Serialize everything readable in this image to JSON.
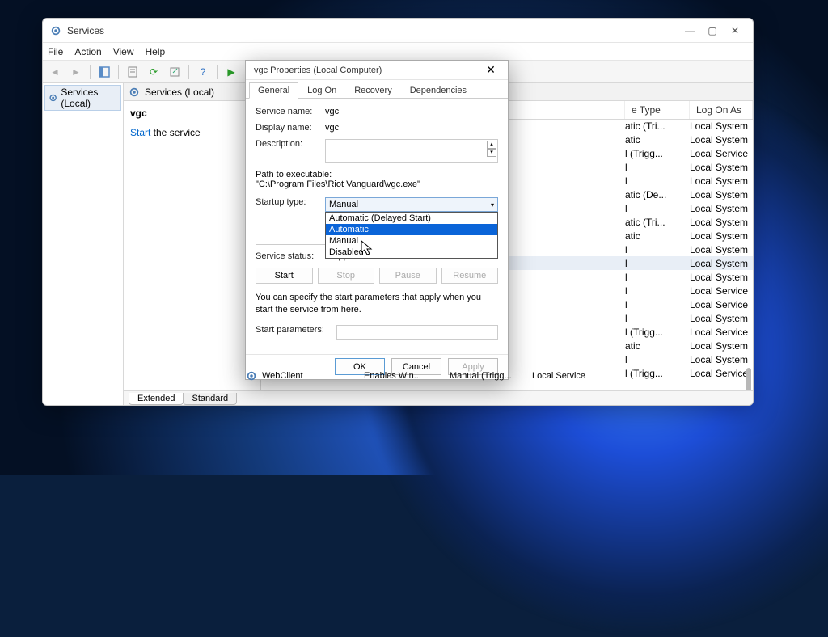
{
  "window": {
    "title": "Services",
    "menus": [
      "File",
      "Action",
      "View",
      "Help"
    ],
    "tree_label": "Services (Local)",
    "detail_header": "Services (Local)",
    "selected_service": "vgc",
    "action_link": "Start",
    "action_suffix": " the service",
    "bottom_tabs": [
      "Extended",
      "Standard"
    ],
    "columns": {
      "startup": "e Type",
      "logon": "Log On As"
    }
  },
  "rows": [
    {
      "startup": "atic (Tri...",
      "logon": "Local System"
    },
    {
      "startup": "atic",
      "logon": "Local System"
    },
    {
      "startup": "l (Trigg...",
      "logon": "Local Service"
    },
    {
      "startup": "l",
      "logon": "Local System"
    },
    {
      "startup": "l",
      "logon": "Local System"
    },
    {
      "startup": "atic (De...",
      "logon": "Local System"
    },
    {
      "startup": "l",
      "logon": "Local System"
    },
    {
      "startup": "atic (Tri...",
      "logon": "Local System"
    },
    {
      "startup": "atic",
      "logon": "Local System"
    },
    {
      "startup": "l",
      "logon": "Local System"
    },
    {
      "startup": "l",
      "logon": "Local System",
      "sel": true
    },
    {
      "startup": "l",
      "logon": "Local System"
    },
    {
      "startup": "l",
      "logon": "Local Service"
    },
    {
      "startup": "l",
      "logon": "Local Service"
    },
    {
      "startup": "l",
      "logon": "Local System"
    },
    {
      "startup": "l (Trigg...",
      "logon": "Local Service"
    },
    {
      "startup": "atic",
      "logon": "Local System"
    },
    {
      "startup": "l",
      "logon": "Local System"
    },
    {
      "startup": "l (Trigg...",
      "logon": "Local Service"
    }
  ],
  "webclient": {
    "name": "WebClient",
    "desc": "Enables Win...",
    "startup": "Manual (Trigg...",
    "logon": "Local Service"
  },
  "dialog": {
    "title": "vgc Properties (Local Computer)",
    "tabs": [
      "General",
      "Log On",
      "Recovery",
      "Dependencies"
    ],
    "labels": {
      "service_name": "Service name:",
      "display_name": "Display name:",
      "description": "Description:",
      "path": "Path to executable:",
      "startup_type": "Startup type:",
      "status": "Service status:",
      "note": "You can specify the start parameters that apply when you start the service from here.",
      "start_params": "Start parameters:"
    },
    "values": {
      "service_name": "vgc",
      "display_name": "vgc",
      "path": "\"C:\\Program Files\\Riot Vanguard\\vgc.exe\"",
      "startup_selected": "Manual",
      "status": "Stopped"
    },
    "dropdown": [
      "Automatic (Delayed Start)",
      "Automatic",
      "Manual",
      "Disabled"
    ],
    "dropdown_highlight": 1,
    "svc_buttons": {
      "start": "Start",
      "stop": "Stop",
      "pause": "Pause",
      "resume": "Resume"
    },
    "footer": {
      "ok": "OK",
      "cancel": "Cancel",
      "apply": "Apply"
    }
  }
}
